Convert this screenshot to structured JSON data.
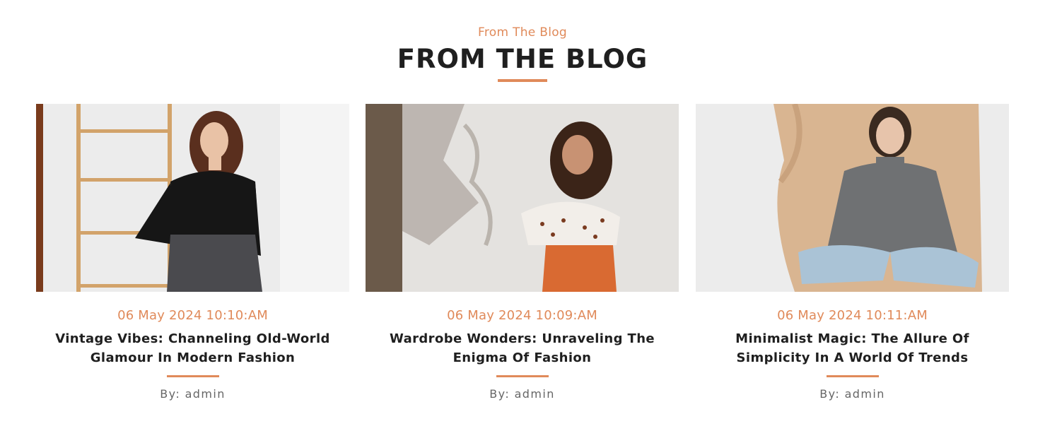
{
  "section": {
    "subtitle": "From The Blog",
    "title": "FROM THE BLOG"
  },
  "colors": {
    "accent": "#e08a5a",
    "heading": "#1f1f1f",
    "author": "#666666"
  },
  "posts": [
    {
      "image": "photo-woman-black-turtleneck-ladder",
      "date": "06 May 2024 10:10:AM",
      "title": "Vintage Vibes: Channeling Old-World Glamour In Modern Fashion",
      "author": "By: admin"
    },
    {
      "image": "photo-woman-floral-top-orange-skirt",
      "date": "06 May 2024 10:09:AM",
      "title": "Wardrobe Wonders: Unraveling The Enigma Of Fashion",
      "author": "By: admin"
    },
    {
      "image": "photo-woman-grey-sweater-seated",
      "date": "06 May 2024 10:11:AM",
      "title": "Minimalist Magic: The Allure Of Simplicity In A World Of Trends",
      "author": "By: admin"
    }
  ]
}
